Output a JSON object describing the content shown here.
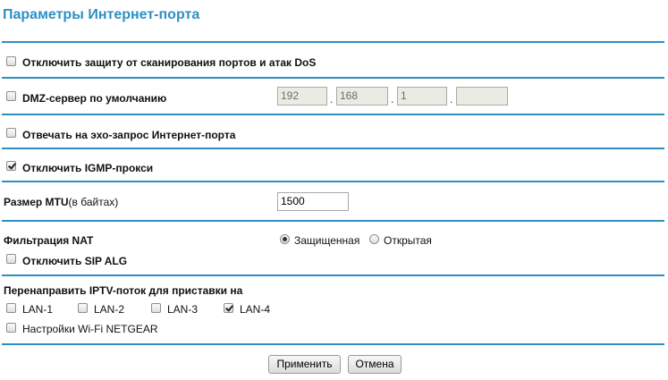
{
  "page": {
    "title": "Параметры Интернет-порта"
  },
  "port_scan": {
    "label": "Отключить защиту от сканирования портов и атак DoS",
    "checked": false
  },
  "dmz": {
    "label": "DMZ-сервер по умолчанию",
    "checked": false,
    "ip": [
      "192",
      "168",
      "1",
      ""
    ],
    "separator": "."
  },
  "ping": {
    "label": "Отвечать на эхо-запрос Интернет-порта",
    "checked": false
  },
  "igmp": {
    "label": "Отключить IGMP-прокси",
    "checked": true
  },
  "mtu": {
    "label": "Размер MTU",
    "unit": "(в байтах)",
    "value": "1500"
  },
  "nat": {
    "label": "Фильтрация NAT",
    "options": [
      {
        "label": "Защищенная",
        "selected": true
      },
      {
        "label": "Открытая",
        "selected": false
      }
    ]
  },
  "sip": {
    "label": "Отключить SIP ALG",
    "checked": false
  },
  "iptv": {
    "label": "Перенаправить IPTV-поток для приставки на",
    "ports": [
      {
        "label": "LAN-1",
        "checked": false
      },
      {
        "label": "LAN-2",
        "checked": false
      },
      {
        "label": "LAN-3",
        "checked": false
      },
      {
        "label": "LAN-4",
        "checked": true
      }
    ],
    "wifi": {
      "label": "Настройки Wi-Fi NETGEAR",
      "checked": false
    }
  },
  "actions": {
    "apply": "Применить",
    "cancel": "Отмена"
  }
}
